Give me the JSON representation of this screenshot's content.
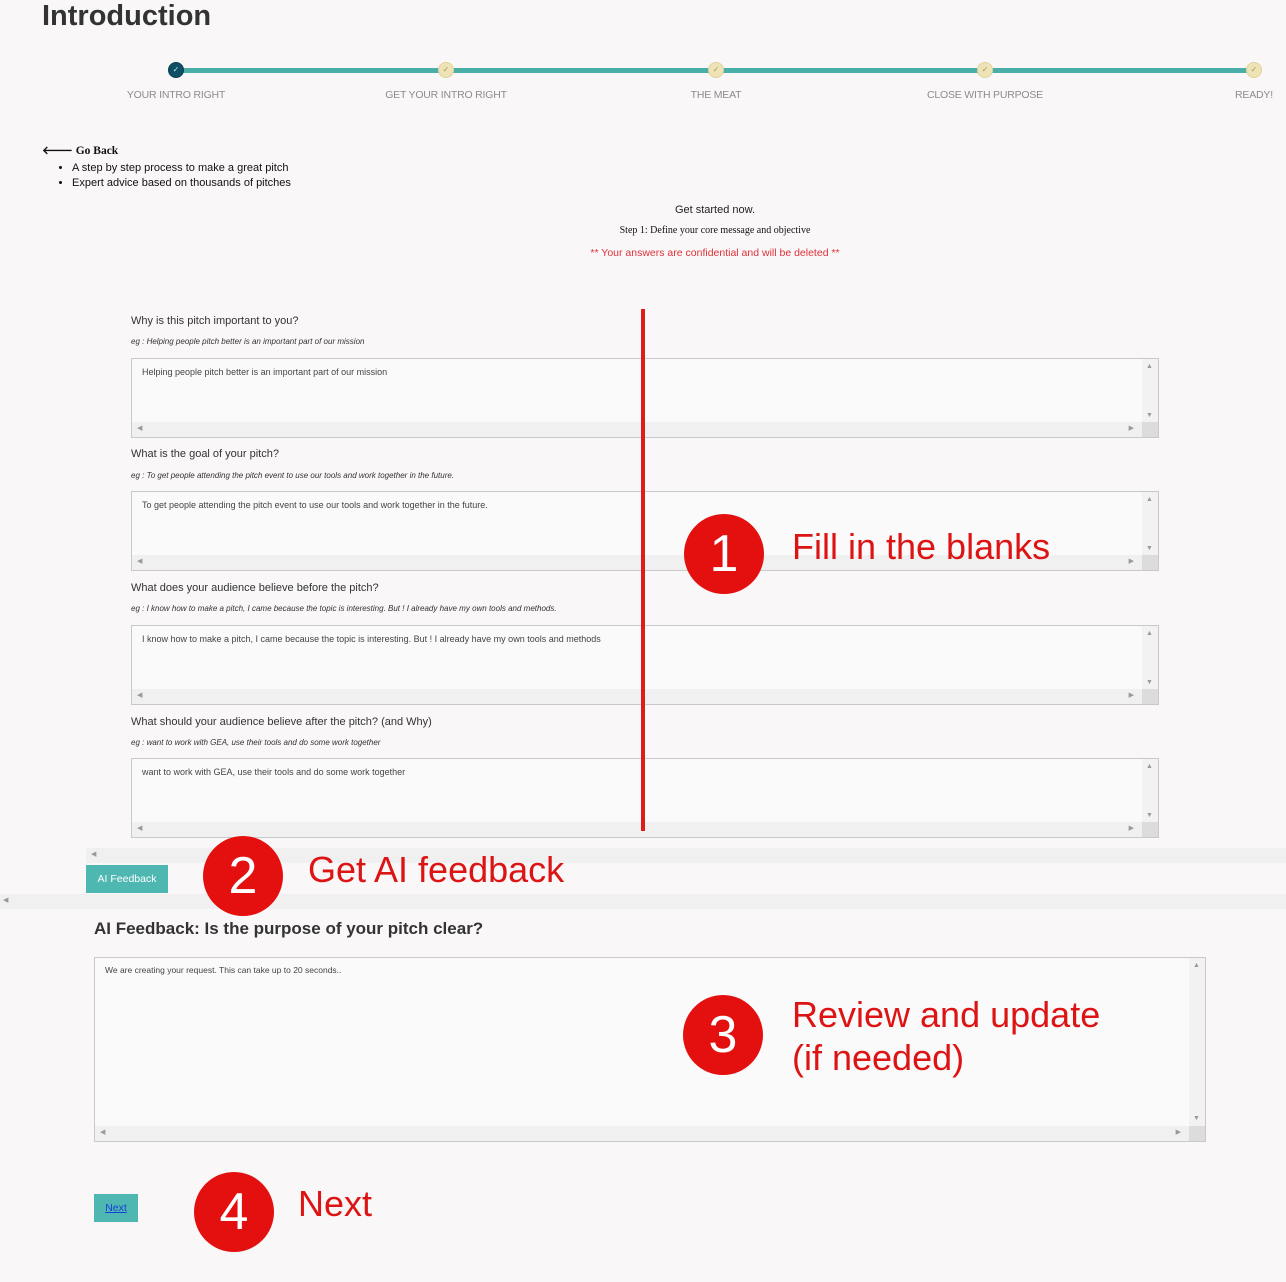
{
  "page": {
    "title": "Introduction"
  },
  "stepper": {
    "steps": [
      {
        "label": "YOUR INTRO RIGHT",
        "state": "current"
      },
      {
        "label": "GET YOUR INTRO RIGHT",
        "state": "done"
      },
      {
        "label": "THE MEAT",
        "state": "done"
      },
      {
        "label": "CLOSE WITH PURPOSE",
        "state": "done"
      },
      {
        "label": "READY!",
        "state": "done"
      }
    ],
    "check_glyph": "✓"
  },
  "nav": {
    "go_back": "🡐 Go Back"
  },
  "intro": {
    "bullets": [
      "A step by step process to make a great pitch",
      "Expert advice based on thousands of pitches"
    ],
    "get_started": "Get started now.",
    "step_title": "Step 1: Define your core message and objective",
    "confidential": "** Your answers are confidential and will be deleted **"
  },
  "questions": [
    {
      "label": "Why is this pitch important to you?",
      "example": "eg : Helping people pitch better is an important part of our mission",
      "value": "Helping people pitch better is an important part of our mission"
    },
    {
      "label": "What is the goal of your pitch?",
      "example": "eg : To get people attending the pitch event to use our tools and work together in the future.",
      "value": "To get people attending the pitch event to use our tools and work together in the future."
    },
    {
      "label": "What does your audience believe before the pitch?",
      "example": "eg : I know how to make a pitch, I came because the topic is interesting. But ! I already have my own tools and methods.",
      "value": " I know how to make a pitch, I came because the topic is interesting. But ! I already have my own tools and methods"
    },
    {
      "label": "What should your audience believe after the pitch? (and Why)",
      "example": "eg : want to work with GEA, use their tools and do some work together",
      "value": "want to work with GEA, use their tools and do some work together"
    }
  ],
  "ai": {
    "button_label": "AI Feedback",
    "feedback_title": "AI Feedback: Is the purpose of your pitch clear?",
    "feedback_text": "We are creating your request. This can take up to 20 seconds.."
  },
  "next": {
    "label": "Next"
  },
  "annotations": {
    "color": "#e3100f",
    "items": [
      {
        "number": "1",
        "text": "Fill in the blanks"
      },
      {
        "number": "2",
        "text": "Get AI feedback"
      },
      {
        "number": "3",
        "text": "Review and update",
        "text2": "(if needed)"
      },
      {
        "number": "4",
        "text": "Next"
      }
    ]
  }
}
